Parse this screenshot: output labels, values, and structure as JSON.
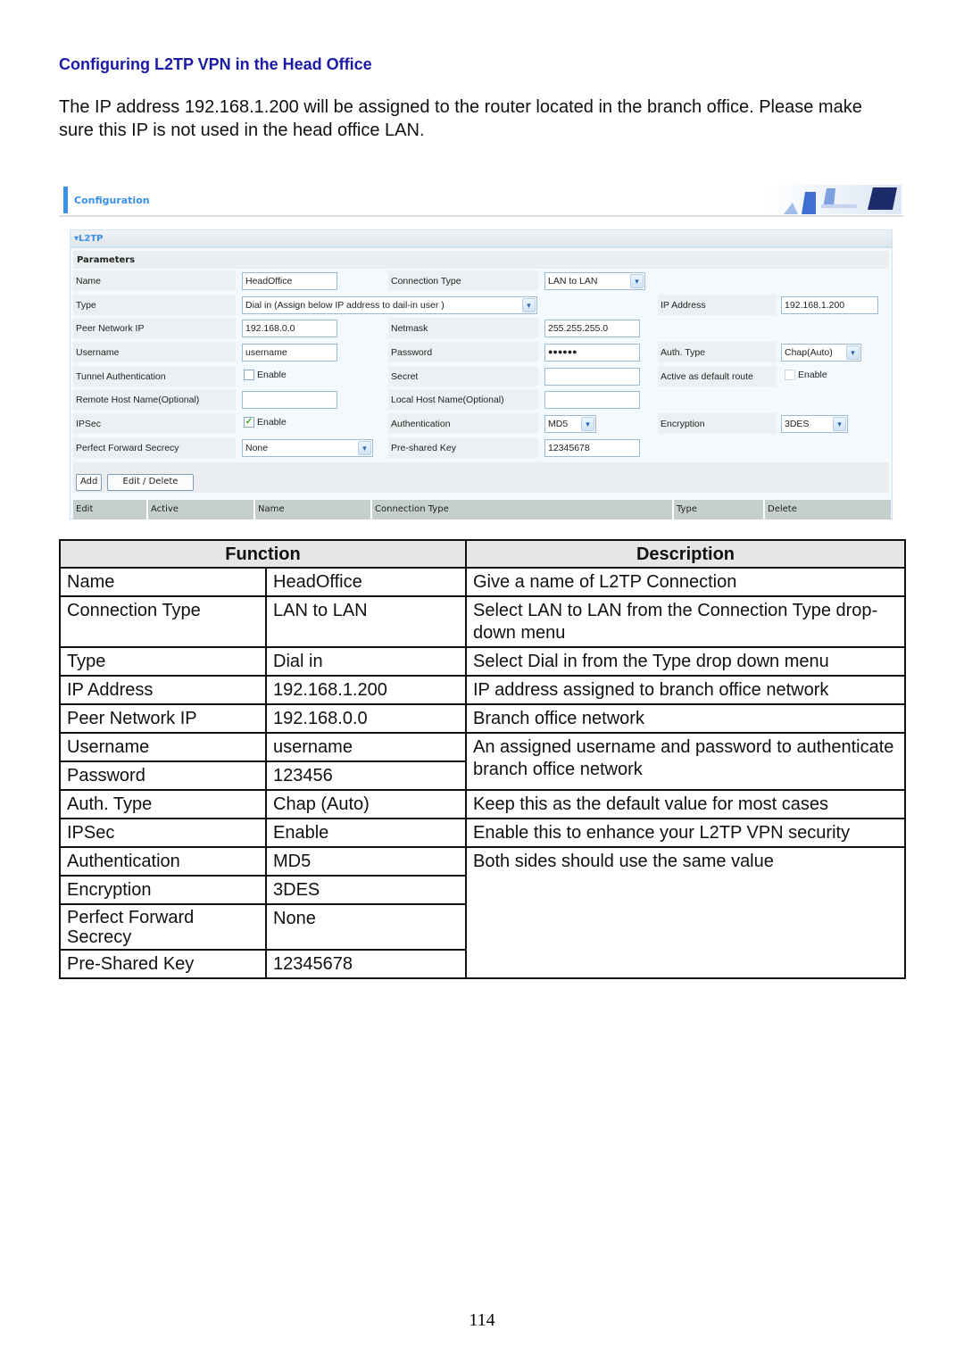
{
  "heading": "Configuring L2TP VPN in the Head Office",
  "intro": "The IP address 192.168.1.200 will be assigned to the router located in the branch office. Please make sure this IP is not used in the head office LAN.",
  "config": {
    "title": "Configuration",
    "section": "L2TP",
    "params_label": "Parameters",
    "rows": [
      {
        "l1": "Name",
        "v1": "HeadOffice",
        "l2": "Connection Type",
        "v2": "LAN to LAN"
      },
      {
        "l1": "Type",
        "v1": "Dial in (Assign below IP address to dail-in user )",
        "l3": "IP Address",
        "v3": "192.168.1.200"
      },
      {
        "l1": "Peer Network IP",
        "v1": "192.168.0.0",
        "l2": "Netmask",
        "v2": "255.255.255.0"
      },
      {
        "l1": "Username",
        "v1": "username",
        "l2": "Password",
        "v2": "●●●●●●",
        "l3": "Auth. Type",
        "v3": "Chap(Auto)"
      },
      {
        "l1": "Tunnel Authentication",
        "v1": "Enable",
        "l2": "Secret",
        "v2": "",
        "l3": "Active as default route",
        "v3": "Enable"
      },
      {
        "l1": "Remote Host Name(Optional)",
        "v1": "",
        "l2": "Local Host Name(Optional)",
        "v2": ""
      },
      {
        "l1": "IPSec",
        "v1": "Enable",
        "l2": "Authentication",
        "v2": "MD5",
        "l3": "Encryption",
        "v3": "3DES"
      },
      {
        "l1": "Perfect Forward Secrecy",
        "v1": "None",
        "l2": "Pre-shared Key",
        "v2": "12345678"
      }
    ],
    "checks": {
      "tunnel_auth": false,
      "ipsec": true,
      "default_route": false
    },
    "buttons": {
      "add": "Add",
      "edit_delete": "Edit / Delete"
    },
    "list_columns": [
      "Edit",
      "Active",
      "Name",
      "Connection Type",
      "Type",
      "Delete"
    ]
  },
  "table": {
    "headers": {
      "function": "Function",
      "description": "Description"
    },
    "rows": [
      {
        "name": "Name",
        "value": "HeadOffice",
        "desc": "Give a name of L2TP Connection"
      },
      {
        "name": "Connection Type",
        "value": "LAN to LAN",
        "desc": "Select LAN to LAN from the Connection Type drop-down menu"
      },
      {
        "name": "Type",
        "value": "Dial in",
        "desc": "Select Dial in from the Type drop down menu"
      },
      {
        "name": "IP Address",
        "value": "192.168.1.200",
        "desc": "IP address assigned to branch office network"
      },
      {
        "name": "Peer Network IP",
        "value": "192.168.0.0",
        "desc": "Branch office network"
      },
      {
        "name": "Username",
        "value": "username",
        "desc": "An assigned username and password to authenticate branch office network"
      },
      {
        "name": "Password",
        "value": "123456"
      },
      {
        "name": "Auth. Type",
        "value": "Chap (Auto)",
        "desc": "Keep this as the default value for most cases"
      },
      {
        "name": "IPSec",
        "value": "Enable",
        "desc": "Enable this to enhance your L2TP VPN security"
      },
      {
        "name": "Authentication",
        "value": "MD5",
        "desc": "Both sides should use the same value"
      },
      {
        "name": "Encryption",
        "value": "3DES"
      },
      {
        "name": "Perfect Forward Secrecy",
        "value": "None"
      },
      {
        "name": "Pre-Shared Key",
        "value": "12345678"
      }
    ]
  },
  "page_number": "114"
}
